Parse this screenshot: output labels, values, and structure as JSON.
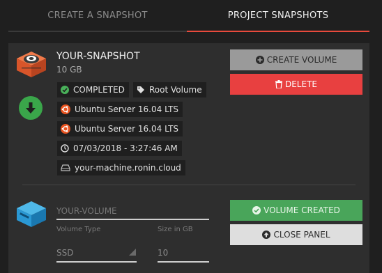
{
  "tabs": [
    {
      "label": "CREATE A SNAPSHOT",
      "active": false
    },
    {
      "label": "PROJECT SNAPSHOTS",
      "active": true
    }
  ],
  "snapshot": {
    "name": "YOUR-SNAPSHOT",
    "size": "10 GB",
    "status": "COMPLETED",
    "type": "Root Volume",
    "os_1": "Ubuntu Server 16.04 LTS",
    "os_2": "Ubuntu Server 16.04 LTS",
    "created": "07/03/2018 - 3:27:46 AM",
    "machine": "your-machine.ronin.cloud"
  },
  "actions": {
    "create_volume": "CREATE VOLUME",
    "delete": "DELETE"
  },
  "volume_form": {
    "name_placeholder": "YOUR-VOLUME",
    "type_label": "Volume Type",
    "type_value": "SSD",
    "size_label": "Size in GB",
    "size_value": "10",
    "created_button": "VOLUME CREATED",
    "close_button": "CLOSE PANEL"
  },
  "colors": {
    "accent": "#e84a3c",
    "delete": "#e84040",
    "success": "#49a55a",
    "ubuntu": "#e95420"
  },
  "icons": {
    "snapshot": "snapshot-camera-icon",
    "download": "download-arrow-icon",
    "status": "check-circle-icon",
    "type": "tag-icon",
    "os": "ubuntu-icon",
    "time": "clock-icon",
    "machine": "hard-drive-icon",
    "volume": "volume-cube-icon"
  }
}
